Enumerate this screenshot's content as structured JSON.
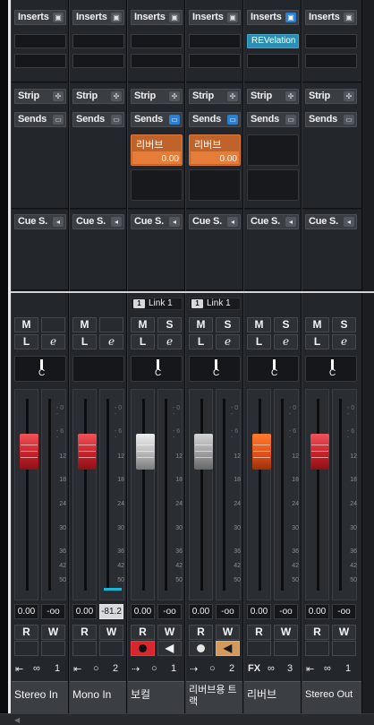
{
  "labels": {
    "inserts": "Inserts",
    "strip": "Strip",
    "sends": "Sends",
    "cue": "Cue S.",
    "mute": "M",
    "listen": "L",
    "solo": "S",
    "edit": "e",
    "read": "R",
    "write": "W",
    "center": "C"
  },
  "icons": {
    "insert_toggle": "insert-rack-icon",
    "strip_toggle": "strip-rack-icon",
    "sends_toggle": "monitor-icon",
    "cue_toggle": "speaker-icon",
    "link": "link-icon",
    "input": "input-routing-icon",
    "stereo": "stereo-icon",
    "mono": "mono-icon",
    "fx": "fx-icon"
  },
  "colors": {
    "background": "#1b1d20",
    "panel": "#23262a",
    "send_orange": "#e57d38",
    "plugin_blue": "#2a8fb5",
    "fader_red": "#c8212a",
    "record_red": "#d8262e",
    "monitor_tan": "#d39a5d",
    "meter_peak": "#19b6d8"
  },
  "meter_scale": [
    "- 0 -",
    "- 6 -",
    "12",
    "18",
    "24",
    "30",
    "36",
    "42",
    "50"
  ],
  "channels": [
    {
      "name": "Stereo In",
      "inserts": [],
      "sends": [],
      "link": "",
      "fader_db": "0.00",
      "pan": "-oo",
      "icon_a": "⇤",
      "icon_b": "∞",
      "number": "1",
      "fader_color": "red"
    },
    {
      "name": "Mono In",
      "inserts": [],
      "sends": [],
      "link": "",
      "fader_db": "0.00",
      "pan": "-81.2",
      "icon_a": "⇤",
      "icon_b": "○",
      "number": "2",
      "fader_color": "red"
    },
    {
      "name": "보컬",
      "inserts": [],
      "sends": [
        {
          "name": "리버브",
          "value": "0.00"
        }
      ],
      "link": "Link 1",
      "link_num": "1",
      "fader_db": "0.00",
      "pan": "-oo",
      "icon_a": "⇢",
      "icon_b": "○",
      "number": "1",
      "fader_color": "grey"
    },
    {
      "name": "리버브용 트랙",
      "inserts": [],
      "sends": [
        {
          "name": "리버브",
          "value": "0.00"
        }
      ],
      "link": "Link 1",
      "link_num": "1",
      "fader_db": "0.00",
      "pan": "-oo",
      "icon_a": "⇢",
      "icon_b": "○",
      "number": "2",
      "fader_color": "grey"
    },
    {
      "name": "리버브",
      "inserts": [
        "REVelation"
      ],
      "sends": [],
      "link": "",
      "fader_db": "0.00",
      "pan": "-oo",
      "icon_a": "FX",
      "icon_b": "∞",
      "number": "3",
      "fader_color": "orange"
    },
    {
      "name": "Stereo Out",
      "inserts": [],
      "sends": [],
      "link": "",
      "fader_db": "0.00",
      "pan": "-oo",
      "icon_a": "⇤",
      "icon_b": "∞",
      "number": "1",
      "fader_color": "red"
    }
  ]
}
